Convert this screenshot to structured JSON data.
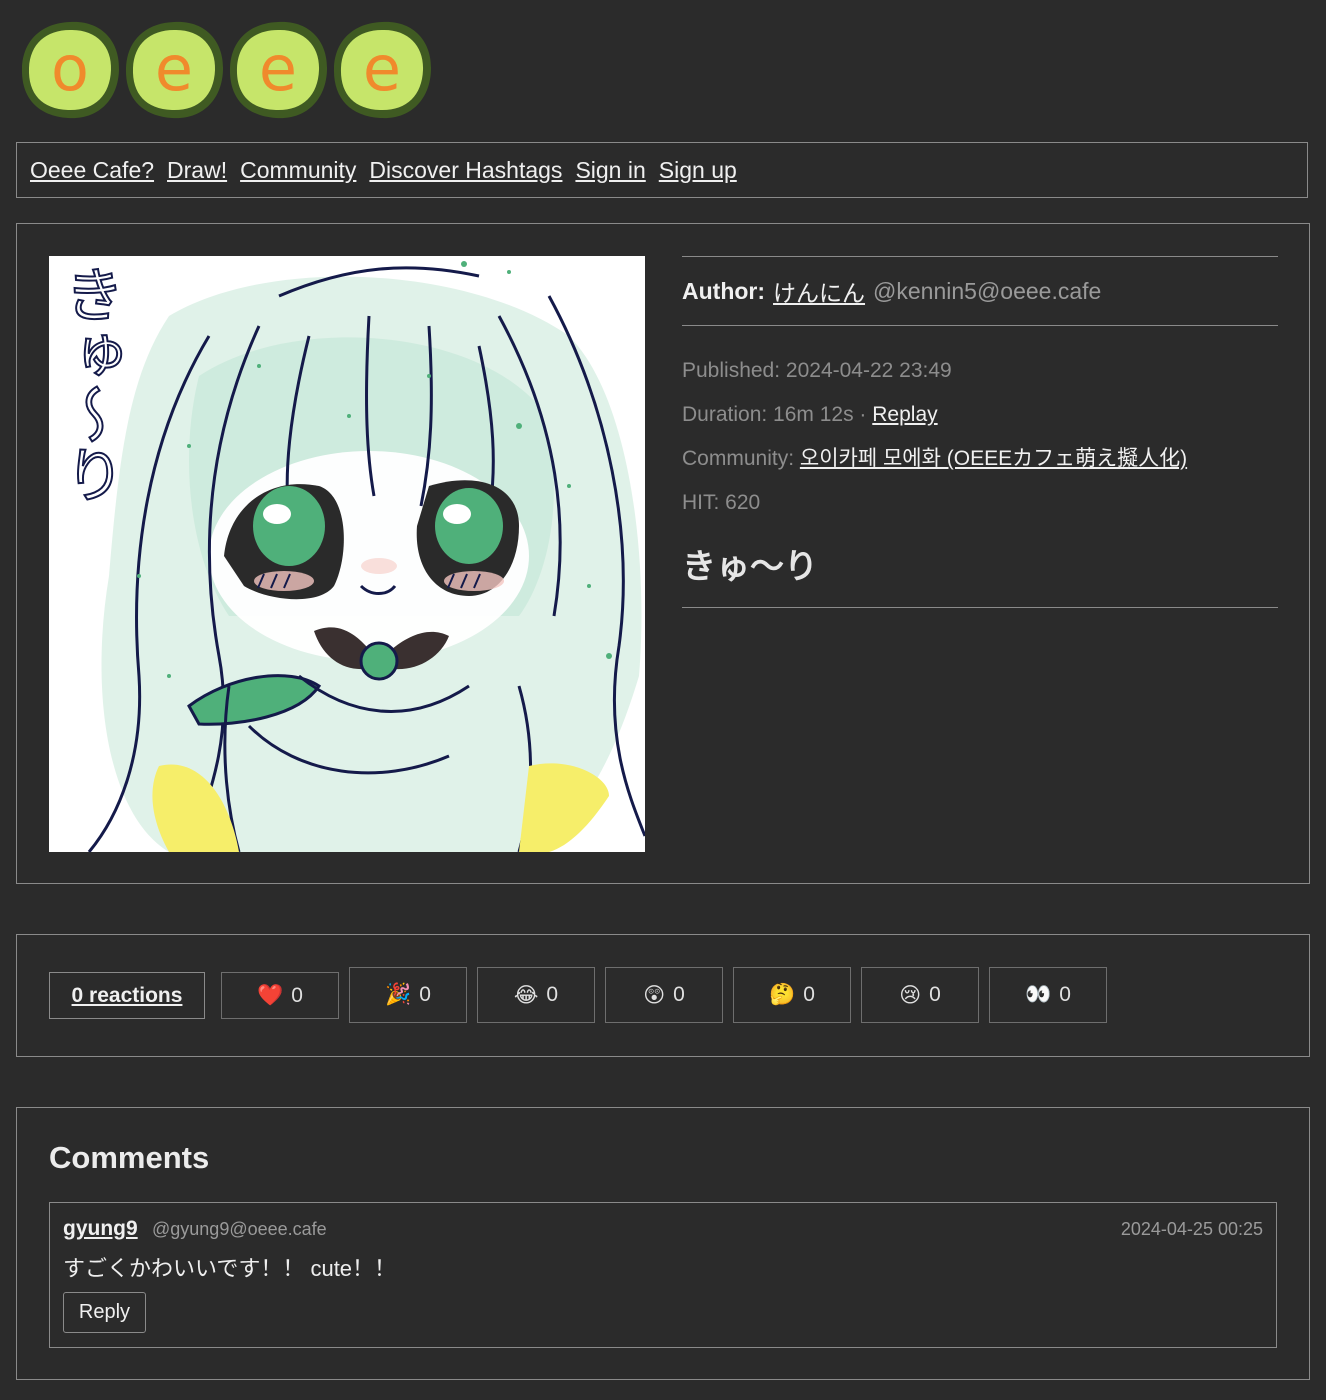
{
  "logo": {
    "letters": [
      "o",
      "e",
      "e",
      "e"
    ]
  },
  "nav": {
    "items": [
      {
        "label": "Oeee Cafe?"
      },
      {
        "label": "Draw!"
      },
      {
        "label": "Community"
      },
      {
        "label": "Discover Hashtags"
      },
      {
        "label": "Sign in"
      },
      {
        "label": "Sign up"
      }
    ]
  },
  "post": {
    "author_label": "Author:",
    "author_name": "けんにん",
    "author_handle": "@kennin5@oeee.cafe",
    "published": "Published: 2024-04-22 23:49",
    "duration": "Duration: 16m 12s ·",
    "replay_label": "Replay",
    "community_label": "Community:",
    "community_name": "오이카페 모에화 (OEEEカフェ萌え擬人化)",
    "hit": "HIT: 620",
    "title": "きゅ～り",
    "artwork_text": "きゅ～り"
  },
  "reactions": {
    "total_label": "0 reactions",
    "items": [
      {
        "icon": "heart-icon",
        "emoji": "❤️",
        "count": "0"
      },
      {
        "icon": "party-popper-icon",
        "emoji": "🎉",
        "count": "0"
      },
      {
        "icon": "laughing-icon",
        "emoji": "😂",
        "count": "0"
      },
      {
        "icon": "astonished-icon",
        "emoji": "😲",
        "count": "0"
      },
      {
        "icon": "thinking-icon",
        "emoji": "🤔",
        "count": "0"
      },
      {
        "icon": "crying-icon",
        "emoji": "😢",
        "count": "0"
      },
      {
        "icon": "eyes-icon",
        "emoji": "👀",
        "count": "0"
      }
    ]
  },
  "comments": {
    "heading": "Comments",
    "items": [
      {
        "user": "gyung9",
        "handle": "@gyung9@oeee.cafe",
        "date": "2024-04-25 00:25",
        "body": "すごくかわいいです！！ cute！！",
        "reply_label": "Reply"
      }
    ]
  },
  "colors": {
    "background": "#2b2b2b",
    "border": "#8a8a8a",
    "logo_green": "#c6e56a",
    "logo_orange": "#f08a2c"
  }
}
